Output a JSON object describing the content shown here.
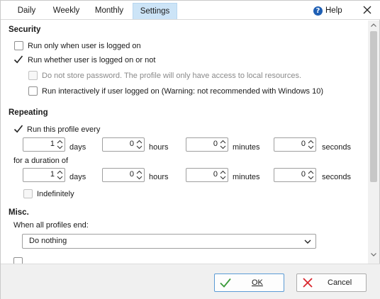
{
  "tabs": {
    "daily": "Daily",
    "weekly": "Weekly",
    "monthly": "Monthly",
    "settings": "Settings",
    "active": "Settings"
  },
  "help_label": "Help",
  "security": {
    "heading": "Security",
    "opt_logged_on": "Run only when user is logged on",
    "opt_logged_on_checked": false,
    "opt_whether": "Run whether user is logged on or not",
    "opt_whether_checked": true,
    "no_store_password": "Do not store password. The profile will only have access to local resources.",
    "no_store_password_checked": false,
    "interactively": "Run interactively if user logged on (Warning: not recommended with Windows 10)",
    "interactively_checked": false
  },
  "repeating": {
    "heading": "Repeating",
    "run_every_label": "Run this profile every",
    "run_every_checked": true,
    "every": {
      "days": "1",
      "hours": "0",
      "minutes": "0",
      "seconds": "0"
    },
    "duration_label": "for a duration of",
    "duration": {
      "days": "1",
      "hours": "0",
      "minutes": "0",
      "seconds": "0"
    },
    "unit_days": "days",
    "unit_hours": "hours",
    "unit_minutes": "minutes",
    "unit_seconds": "seconds",
    "indefinitely": "Indefinitely",
    "indefinitely_checked": false
  },
  "misc": {
    "heading": "Misc.",
    "when_all_end": "When all profiles end:",
    "action_selected": "Do nothing"
  },
  "buttons": {
    "ok": "OK",
    "cancel": "Cancel"
  },
  "colors": {
    "active_tab": "#cce4f7",
    "ok_check": "#3a9a3a",
    "cancel_x": "#d9262c",
    "help_icon": "#1f5fb4"
  }
}
